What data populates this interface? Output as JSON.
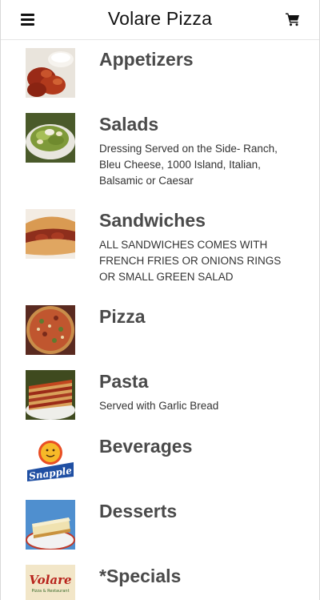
{
  "header": {
    "title": "Volare Pizza",
    "menu_icon": "hamburger-menu-icon",
    "cart_icon": "shopping-cart-icon"
  },
  "categories": [
    {
      "name": "Appetizers",
      "description": "",
      "image": "chicken-wings-image"
    },
    {
      "name": "Salads",
      "description": "Dressing Served on the Side- Ranch, Bleu Cheese, 1000 Island, Italian, Balsamic or Caesar",
      "image": "salad-image"
    },
    {
      "name": "Sandwiches",
      "description": "ALL SANDWICHES COMES WITH FRENCH FRIES OR ONIONS RINGS OR SMALL GREEN SALAD",
      "image": "sandwich-image"
    },
    {
      "name": "Pizza",
      "description": "",
      "image": "pizza-image"
    },
    {
      "name": "Pasta",
      "description": "Served with Garlic Bread",
      "image": "lasagna-image"
    },
    {
      "name": "Beverages",
      "description": "",
      "image": "snapple-logo-image",
      "image_text": "Snapple"
    },
    {
      "name": "Desserts",
      "description": "",
      "image": "cheesecake-image"
    },
    {
      "name": "*Specials",
      "description": "",
      "image": "volare-logo-image",
      "image_text": "Volare",
      "image_subtext": "Pizza & Restaurant"
    }
  ]
}
